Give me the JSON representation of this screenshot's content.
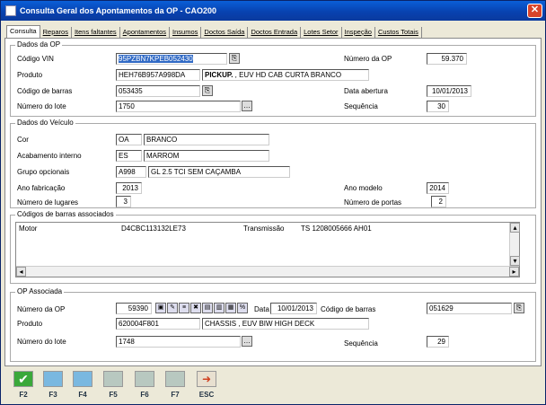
{
  "window": {
    "title": "Consulta Geral dos Apontamentos da OP - CAO200",
    "close": "✕"
  },
  "tabs": [
    "Consulta",
    "Reparos",
    "Itens faltantes",
    "Apontamentos",
    "Insumos",
    "Doctos Saída",
    "Doctos Entrada",
    "Lotes Setor",
    "Inspeção",
    "Custos Totais"
  ],
  "dados_op": {
    "title": "Dados da OP",
    "codigo_vin_label": "Código VIN",
    "codigo_vin": "95PZBN7KPEB052430",
    "numero_op_label": "Número da OP",
    "numero_op": "59.370",
    "produto_label": "Produto",
    "produto_code": "HEH76B957A998DA",
    "produto_desc_bold": "PICKUP.",
    "produto_desc": "EUV HD CAB CURTA BRANCO",
    "codigo_barras_label": "Código de barras",
    "codigo_barras": "053435",
    "data_abertura_label": "Data abertura",
    "data_abertura": "10/01/2013",
    "numero_lote_label": "Número do lote",
    "numero_lote": "1750",
    "sequencia_label": "Sequência",
    "sequencia": "30"
  },
  "dados_veiculo": {
    "title": "Dados do Veículo",
    "cor_label": "Cor",
    "cor_code": "OA",
    "cor_desc": "BRANCO",
    "acabamento_label": "Acabamento interno",
    "acabamento_code": "ES",
    "acabamento_desc": "MARROM",
    "grupo_label": "Grupo opcionais",
    "grupo_code": "A998",
    "grupo_desc": "GL 2.5 TCI SEM CAÇAMBA",
    "ano_fab_label": "Ano fabricação",
    "ano_fab": "2013",
    "ano_modelo_label": "Ano modelo",
    "ano_modelo": "2014",
    "lugares_label": "Número de lugares",
    "lugares": "3",
    "portas_label": "Número de portas",
    "portas": "2"
  },
  "codigos": {
    "title": "Códigos de barras associados",
    "rows": [
      {
        "c1": "Motor",
        "c2": "D4CBC113132LE73",
        "c3": "Transmissão",
        "c4": "TS 1208005666  AH01"
      }
    ]
  },
  "op_assoc": {
    "title": "OP Associada",
    "numero_op_label": "Número da OP",
    "numero_op": "59390",
    "data_label": "Data",
    "data": "10/01/2013",
    "codigo_barras_label": "Código de barras",
    "codigo_barras": "051629",
    "produto_label": "Produto",
    "produto_code": "620004F801",
    "produto_desc": "CHASSIS    , EUV BIW HIGH DECK",
    "numero_lote_label": "Número do lote",
    "numero_lote": "1748",
    "sequencia_label": "Sequência",
    "sequencia": "29"
  },
  "fkeys": [
    {
      "key": "F2",
      "color": "#3aa83a"
    },
    {
      "key": "F3",
      "color": "#7ab8e0"
    },
    {
      "key": "F4",
      "color": "#7ab8e0"
    },
    {
      "key": "F5",
      "color": "#b8c8c0"
    },
    {
      "key": "F6",
      "color": "#b8c8c0"
    },
    {
      "key": "F7",
      "color": "#b8c8c0"
    },
    {
      "key": "ESC",
      "color": "#d04020"
    }
  ]
}
